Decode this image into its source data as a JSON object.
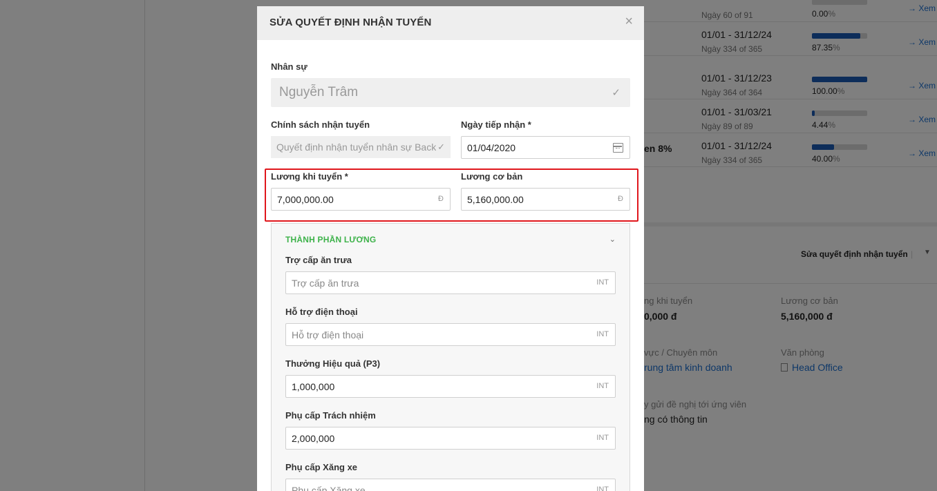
{
  "background": {
    "rows": [
      {
        "period": "",
        "sub": "Ngày 60 of 91",
        "percent": "0.00",
        "pct_value": 0.0,
        "view_label": "Xem"
      },
      {
        "period": "01/01 - 31/12/24",
        "sub": "Ngày 334 of 365",
        "percent": "87.35",
        "pct_value": 87.35,
        "view_label": "Xem"
      },
      {
        "period": "01/01 - 31/12/23",
        "sub": "Ngày 364 of 364",
        "percent": "100.00",
        "pct_value": 100.0,
        "view_label": "Xem"
      },
      {
        "period": "01/01 - 31/03/21",
        "sub": "Ngày 89 of 89",
        "percent": "4.44",
        "pct_value": 4.44,
        "view_label": "Xem"
      },
      {
        "period": "01/01 - 31/12/24",
        "sub": "Ngày 334 of 365",
        "percent": "40.00",
        "pct_value": 40.0,
        "view_label": "Xem",
        "extra": "en 8%"
      }
    ],
    "percent_unit": "%",
    "action_label": "Sửa quyết định nhận tuyển",
    "details": {
      "salary_hire_label": "ng khi tuyển",
      "salary_hire_value": "0,000 đ",
      "salary_base_label": "Lương cơ bản",
      "salary_base_value": "5,160,000 đ",
      "field_label": "vực / Chuyên môn",
      "field_value": "rung tâm kinh doanh",
      "office_label": "Văn phòng",
      "office_value": "Head Office",
      "offer_label": "y gửi đề nghị tới ứng viên",
      "offer_value": "ng có thông tin"
    }
  },
  "modal": {
    "title": "SỬA QUYẾT ĐỊNH NHẬN TUYỂN",
    "close": "×",
    "employee": {
      "label": "Nhân sự",
      "value": "Nguyễn Trâm"
    },
    "policy": {
      "label": "Chính sách nhận tuyển",
      "placeholder": "Quyết định nhận tuyển nhân sự Back"
    },
    "receive_date": {
      "label": "Ngày tiếp nhận *",
      "value": "01/04/2020"
    },
    "hire_salary": {
      "label": "Lương khi tuyển *",
      "value": "7,000,000.00",
      "suffix": "Đ"
    },
    "base_salary": {
      "label": "Lương cơ bản",
      "value": "5,160,000.00",
      "suffix": "Đ"
    },
    "components": {
      "title": "THÀNH PHẦN LƯƠNG",
      "fields": [
        {
          "label": "Trợ cấp ăn trưa",
          "placeholder": "Trợ cấp ăn trưa",
          "value": "",
          "suffix": "INT"
        },
        {
          "label": "Hỗ trợ điện thoại",
          "placeholder": "Hỗ trợ điện thoại",
          "value": "",
          "suffix": "INT"
        },
        {
          "label": "Thưởng Hiệu quả (P3)",
          "placeholder": "",
          "value": "1,000,000",
          "suffix": "INT"
        },
        {
          "label": "Phụ cấp Trách nhiệm",
          "placeholder": "",
          "value": "2,000,000",
          "suffix": "INT"
        },
        {
          "label": "Phụ cấp Xăng xe",
          "placeholder": "Phụ cấp Xăng xe",
          "value": "",
          "suffix": "INT"
        }
      ]
    }
  },
  "colors": {
    "accent_green": "#3db24a",
    "highlight_red": "#e0161c",
    "link_blue": "#1b6fd1",
    "progress_blue": "#1b5bb5"
  }
}
